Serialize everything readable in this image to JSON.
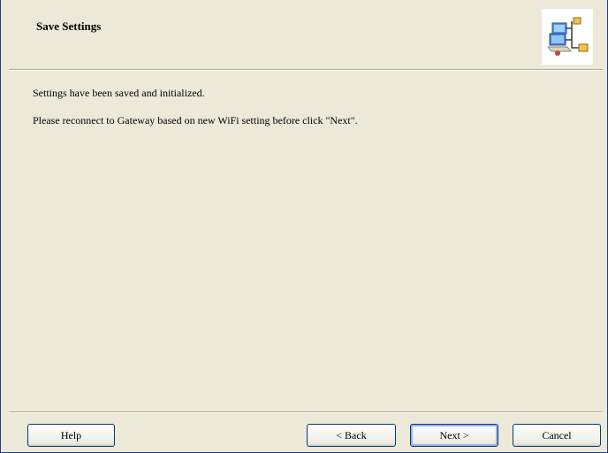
{
  "header": {
    "title": "Save Settings",
    "icon": "network-computers-icon"
  },
  "body": {
    "line1": "Settings have been saved and initialized.",
    "line2": "Please reconnect to Gateway based on new WiFi setting before click \"Next\"."
  },
  "buttons": {
    "help": "Help",
    "back": "< Back",
    "next": "Next >",
    "cancel": "Cancel"
  },
  "colors": {
    "dialog_bg": "#ece9d8",
    "button_border": "#003c74",
    "default_button_focus": "#99b4e8",
    "window_border": "#1c3f94"
  }
}
